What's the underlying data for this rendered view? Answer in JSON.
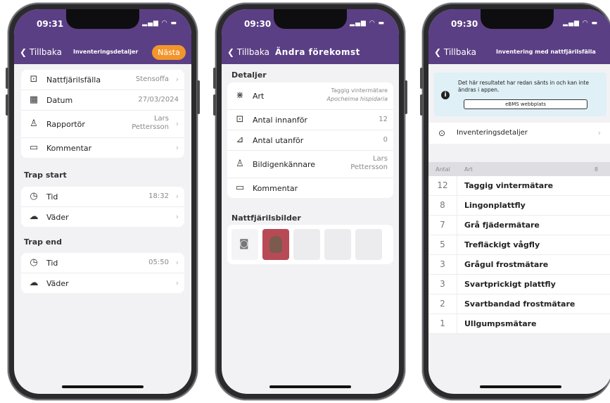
{
  "phone1": {
    "status_time": "09:31",
    "back_label": "Tillbaka",
    "title": "Inventeringsdetaljer",
    "next_label": "Nästa",
    "rows": [
      {
        "label": "Nattfjärilsfälla",
        "value": "Stensoffa"
      },
      {
        "label": "Datum",
        "value": "27/03/2024"
      },
      {
        "label": "Rapportör",
        "value_line1": "Lars",
        "value_line2": "Pettersson"
      },
      {
        "label": "Kommentar",
        "value": ""
      }
    ],
    "trap_start": {
      "heading": "Trap start",
      "time_label": "Tid",
      "time_value": "18:32",
      "weather_label": "Väder"
    },
    "trap_end": {
      "heading": "Trap end",
      "time_label": "Tid",
      "time_value": "05:50",
      "weather_label": "Väder"
    }
  },
  "phone2": {
    "status_time": "09:30",
    "back_label": "Tillbaka",
    "title": "Ändra förekomst",
    "details_heading": "Detaljer",
    "species_label": "Art",
    "species_common": "Taggig vintermätare",
    "species_latin": "Apocheima hispidaria",
    "inside_label": "Antal innanför",
    "inside_value": "12",
    "outside_label": "Antal utanför",
    "outside_value": "0",
    "identifier_label": "Bildigenkännare",
    "identifier_line1": "Lars",
    "identifier_line2": "Pettersson",
    "comment_label": "Kommentar",
    "photos_heading": "Nattfjärilsbilder"
  },
  "phone3": {
    "status_time": "09:30",
    "back_label": "Tillbaka",
    "title": "Inventering med nattfjärilsfälla",
    "info_text": "Det här resultatet har redan sänts in och kan inte ändras i appen.",
    "ebms_button": "eBMS webbplats",
    "details_link": "Inventeringsdetaljer",
    "col_count": "Antal",
    "col_species": "Art",
    "species_total": "8",
    "species": [
      {
        "count": "12",
        "name": "Taggig vintermätare"
      },
      {
        "count": "8",
        "name": "Lingonplattfly"
      },
      {
        "count": "7",
        "name": "Grå fjädermätare"
      },
      {
        "count": "5",
        "name": "Trefläckigt vågfly"
      },
      {
        "count": "3",
        "name": "Grågul frostmätare"
      },
      {
        "count": "3",
        "name": "Svartprickigt plattfly"
      },
      {
        "count": "2",
        "name": "Svartbandad frostmätare"
      },
      {
        "count": "1",
        "name": "Ullgumpsmätare"
      }
    ]
  },
  "colors": {
    "header": "#5b3f84",
    "accent": "#f2962b",
    "info_bg": "#dff0f6"
  }
}
